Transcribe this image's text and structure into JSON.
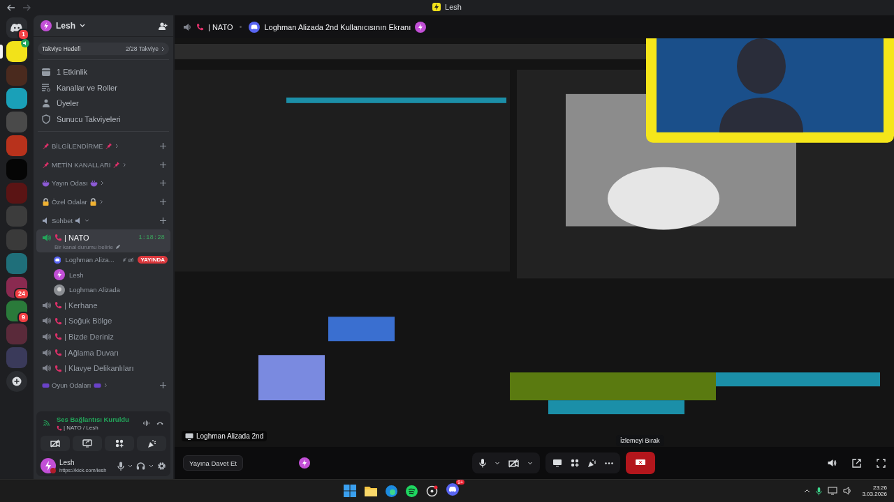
{
  "window": {
    "title": "Lesh"
  },
  "servers": [
    {
      "kind": "home",
      "color": "#2b2d31",
      "badge": "1",
      "selected": false
    },
    {
      "kind": "server",
      "color": "#f2e21a",
      "selected": true
    },
    {
      "kind": "server",
      "color": "#4a2a1e",
      "selected": false
    },
    {
      "kind": "server",
      "color": "#1aa0b8",
      "selected": false
    },
    {
      "kind": "server",
      "color": "#4a4a4a",
      "selected": false
    },
    {
      "kind": "server",
      "color": "#b8321c",
      "selected": false
    },
    {
      "kind": "server",
      "color": "#050505",
      "selected": false
    },
    {
      "kind": "server",
      "color": "#5a1414",
      "selected": false
    },
    {
      "kind": "server",
      "color": "#3c3c3c",
      "selected": false
    },
    {
      "kind": "folder",
      "color": "#3a3a3a",
      "selected": false
    },
    {
      "kind": "folder",
      "color": "#1f6f7a",
      "selected": false
    },
    {
      "kind": "folder",
      "color": "#8a2a50",
      "badge": "24",
      "selected": false
    },
    {
      "kind": "folder",
      "color": "#2a7a3a",
      "badge": "9",
      "selected": false
    },
    {
      "kind": "folder",
      "color": "#5a2a3a",
      "selected": false
    },
    {
      "kind": "folder",
      "color": "#3a3a5a",
      "selected": false
    },
    {
      "kind": "add",
      "selected": false
    }
  ],
  "server": {
    "name": "Lesh",
    "boost_label": "Takviye Hedefi",
    "boost_count": "2/28 Takviye"
  },
  "menu": [
    {
      "kind": "events",
      "label": "1 Etkinlik"
    },
    {
      "kind": "channels",
      "label": "Kanallar ve Roller"
    },
    {
      "kind": "members",
      "label": "Üyeler"
    },
    {
      "kind": "boosts",
      "label": "Sunucu Takviyeleri"
    }
  ],
  "channels": [
    {
      "kind": "pins",
      "label": "BİLGİLENDİRME",
      "expanded": false
    },
    {
      "kind": "pins",
      "label": "METİN KANALLARI",
      "expanded": false
    },
    {
      "kind": "bowls",
      "label": "Yayın Odası",
      "expanded": false
    },
    {
      "kind": "locks",
      "label": "Özel Odalar",
      "expanded": false
    },
    {
      "kind": "speakers",
      "label": "Sohbet",
      "expanded": true
    },
    {
      "kind": "voice",
      "name": "| NATO",
      "selected": true,
      "time": "1:18:28",
      "status": "Bir kanal durumu belirle",
      "members": [
        {
          "name": "Loghman Aliza...",
          "kind": "bot",
          "muted": true,
          "live": "YAYINDA"
        },
        {
          "name": "Lesh",
          "kind": "bolt",
          "muted": false
        },
        {
          "name": "Loghman Alizada",
          "kind": "plain",
          "muted": false
        }
      ]
    },
    {
      "kind": "voice",
      "name": "| Kerhane",
      "selected": false
    },
    {
      "kind": "voice",
      "name": "| Soğuk Bölge",
      "selected": false
    },
    {
      "kind": "voice",
      "name": "| Bizde Deriniz",
      "selected": false
    },
    {
      "kind": "voice",
      "name": "| Ağlama Duvarı",
      "selected": false
    },
    {
      "kind": "voice",
      "name": "| Klavye Delikanlıları",
      "selected": false
    },
    {
      "kind": "gamepads",
      "label": "Oyun Odaları",
      "expanded": false
    }
  ],
  "voice_panel": {
    "status": "Ses Bağlantısı Kuruldu",
    "channel": "| NATO / Lesh"
  },
  "user": {
    "name": "Lesh",
    "status": "https://kick.com/lesh"
  },
  "stream": {
    "channel": "| NATO",
    "title": "Loghman Alizada 2nd Kullanıcısının Ekranı",
    "name_tag": "Loghman Alizada 2nd",
    "tooltip": "İzlemeyi Bırak",
    "invite": "Yayına Davet Et"
  },
  "taskbar": {
    "discord_badge": "9+",
    "time": "23:26",
    "date": "3.03.2026"
  }
}
